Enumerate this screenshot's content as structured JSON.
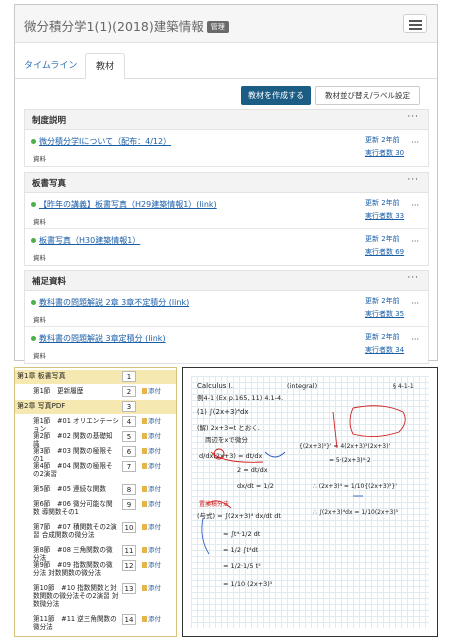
{
  "header": {
    "title": "微分積分学1(1)(2018)建築情報",
    "badge": "管理"
  },
  "tabs": [
    {
      "label": "タイムライン"
    },
    {
      "label": "教材"
    }
  ],
  "toolbar": {
    "create_label": "教材を作成する",
    "sort_label": "教材並び替え/ラベル設定"
  },
  "sections": [
    {
      "title": "制度説明",
      "menu": "···",
      "items": [
        {
          "title": "微分積分学Iについて（配布：4/12）",
          "type": "資料",
          "updated": "更新 2年前",
          "count": "実行者数 30"
        }
      ]
    },
    {
      "title": "板書写真",
      "menu": "···",
      "items": [
        {
          "title": "【昨年の講義】板書写真（H29建築情報1）(link)",
          "type": "資料",
          "updated": "更新 2年前",
          "count": "実行者数 33"
        },
        {
          "title": "板書写真（H30建築情報1）",
          "type": "資料",
          "updated": "更新 2年前",
          "count": "実行者数 69"
        }
      ]
    },
    {
      "title": "補足資料",
      "menu": "···",
      "items": [
        {
          "title": "教科書の問題解説 2章 3章不定積分 (link)",
          "type": "資料",
          "updated": "更新 2年前",
          "count": "実行者数 35"
        },
        {
          "title": "教科書の問題解説 3章定積分 (link)",
          "type": "資料",
          "updated": "更新 2年前",
          "count": "実行者数 34"
        }
      ]
    }
  ],
  "toc": {
    "attach_label": "添付",
    "rows": [
      {
        "text": "第1章 板書写真",
        "num": "1",
        "chapter": true
      },
      {
        "text": "第1節　更新履歴",
        "num": "2"
      },
      {
        "text": "第2章 写真PDF",
        "num": "3",
        "chapter": true
      },
      {
        "text": "第1節　#01 オリエンテーション",
        "num": "4"
      },
      {
        "text": "第2節　#02 関数の基礎知識",
        "num": "5"
      },
      {
        "text": "第3節　#03 関数の極限その1",
        "num": "6"
      },
      {
        "text": "第4節　#04 関数の極限その2演習",
        "num": "7"
      },
      {
        "text": "第5節　#05 連続な関数",
        "num": "8"
      },
      {
        "text": "第6節　#06 微分可能な関数 導関数その1",
        "num": "9"
      },
      {
        "text": "第7節　#07 積関数その2演習 合成関数の微分法",
        "num": "10"
      },
      {
        "text": "第8節　#08 三角関数の微分法",
        "num": "11"
      },
      {
        "text": "第9節　#09 指数関数の微分法 対数関数の微分法",
        "num": "12"
      },
      {
        "text": "第10節　#10 指数関数と対数関数の微分法その2演習 対数微分法",
        "num": "13"
      },
      {
        "text": "第11節　#11 逆三角関数の微分法",
        "num": "14"
      },
      {
        "text": "第12節　#12 陰に定数表示された関数の微分法",
        "num": "15"
      },
      {
        "text": "第13節　#13 高階導関数",
        "num": "16"
      }
    ]
  },
  "notes": {
    "lines": [
      "Calculus I.",
      "(integral)",
      "例4-1 (Ex p.165, 11) 4.1-4.",
      "(1) ∫(2x+3)⁴dx",
      "(解) 2x+3=t とおく.",
      "両辺をxで微分",
      "d/dx(2x+3) = dt/dx",
      "2 = dt/dx",
      "dx/dt = 1/2",
      "(与式) = ∫(2x+3)⁴ dx/dt dt",
      "= ∫t⁴·1/2 dt",
      "= 1/2 ∫t⁴dt",
      "= 1/2·1/5 t⁵",
      "= 1/10 (2x+3)⁵",
      "{(2x+3)⁵}' = 4(2x+3)³(2x+3)'",
      "= 5·(2x+3)⁴·2",
      "∴ (2x+3)⁴ = 1/10{(2x+3)⁵}'",
      "∴ ∫(2x+3)⁴dx = 1/10(2x+3)⁵",
      "§ 4-1-1",
      "置換積分法"
    ]
  }
}
